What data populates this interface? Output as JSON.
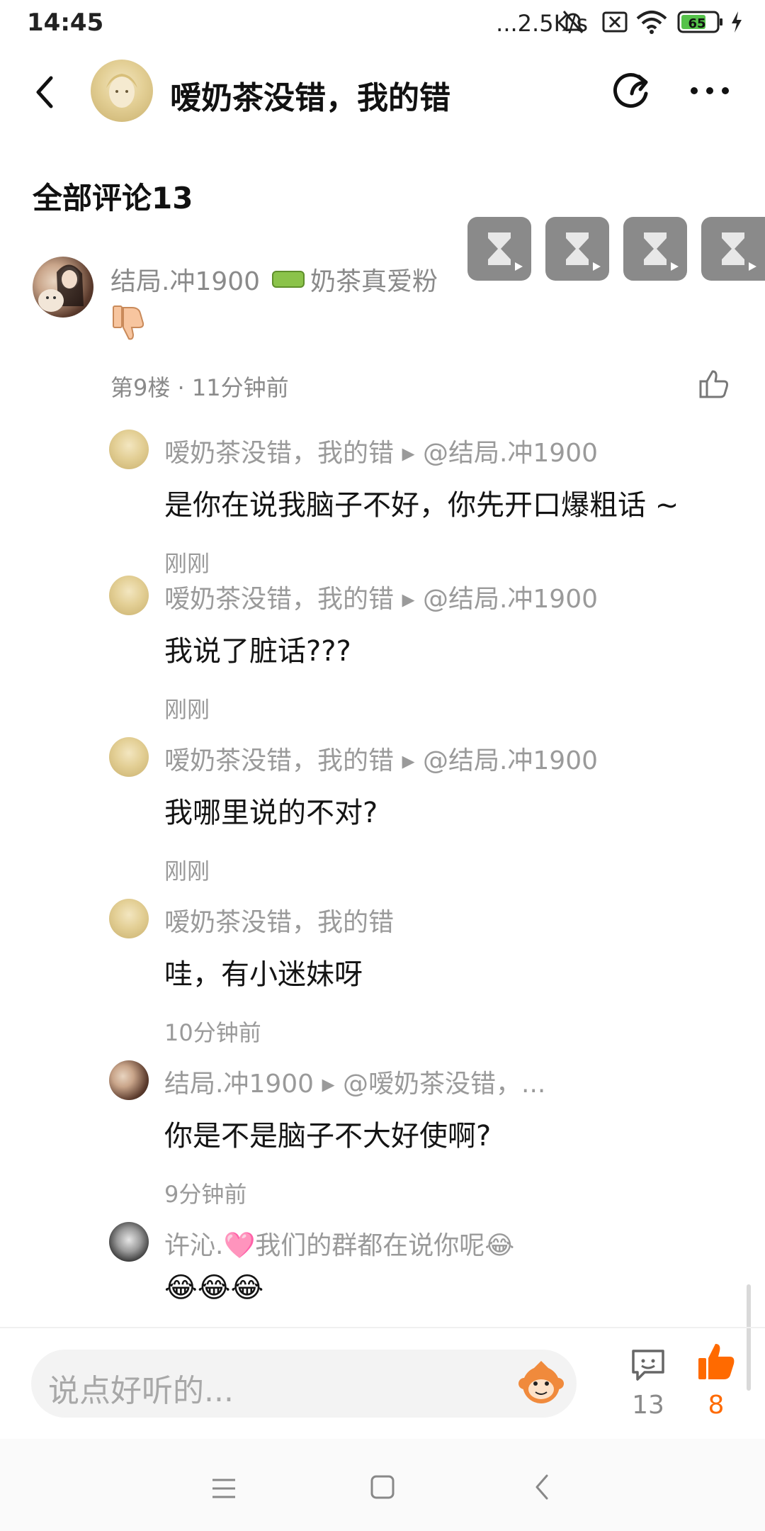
{
  "status_bar": {
    "time": "14:45",
    "network_speed": "...2.5K/s",
    "battery": "65"
  },
  "header": {
    "title": "嗳奶茶没错，我的错"
  },
  "section": {
    "title": "全部评论13"
  },
  "main_comment": {
    "username": "结局.冲1900",
    "fan_badge": "奶茶真爱粉",
    "content_icon": "thumbs-down-emoji",
    "floor_time": "第9楼 · 11分钟前"
  },
  "replies": [
    {
      "head": "嗳奶茶没错，我的错 ▸ @结局.冲1900",
      "text": "是你在说我脑子不好，你先开口爆粗话 ~",
      "time": "刚刚"
    },
    {
      "head": "嗳奶茶没错，我的错 ▸ @结局.冲1900",
      "text": "我说了脏话???",
      "time": "刚刚"
    },
    {
      "head": "嗳奶茶没错，我的错 ▸ @结局.冲1900",
      "text": "我哪里说的不对?",
      "time": "刚刚"
    },
    {
      "head": "嗳奶茶没错，我的错",
      "text": "哇，有小迷妹呀",
      "time": "10分钟前"
    },
    {
      "head": "结局.冲1900 ▸ @嗳奶茶没错，...",
      "text": "你是不是脑子不大好使啊?",
      "time": "9分钟前"
    },
    {
      "head": "许沁.🩷我们的群都在说你呢😂",
      "text": "😂😂😂",
      "time": ""
    }
  ],
  "input": {
    "placeholder": "说点好听的..."
  },
  "actions": {
    "comment_count": "13",
    "like_count": "8"
  },
  "colors": {
    "accent": "#ff6a00",
    "muted": "#8a8a8a"
  }
}
